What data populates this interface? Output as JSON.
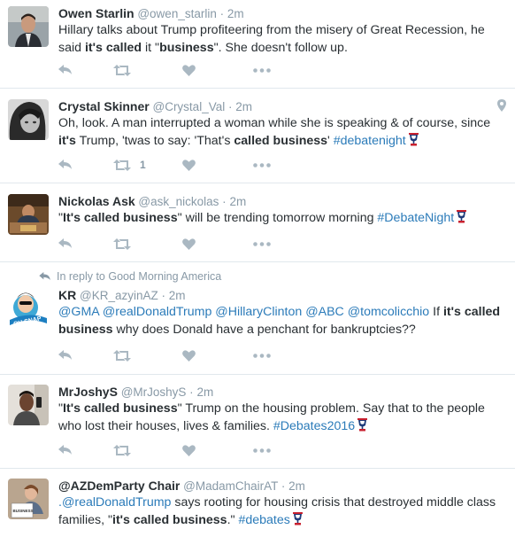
{
  "tweets": [
    {
      "name": "Owen Starlin",
      "handle": "@owen_starlin",
      "time": "2m",
      "text_parts": [
        {
          "t": "Hillary talks about Trump profiteering from the misery of Great Recession, he said ",
          "style": "plain"
        },
        {
          "t": "it's called",
          "style": "bold"
        },
        {
          "t": " it \"",
          "style": "plain"
        },
        {
          "t": "business",
          "style": "bold"
        },
        {
          "t": "\".  She doesn't follow up.",
          "style": "plain"
        }
      ],
      "retweet_count": ""
    },
    {
      "name": "Crystal Skinner",
      "handle": "@Crystal_Val",
      "time": "2m",
      "text_parts": [
        {
          "t": "Oh, look. A man interrupted a woman while she is speaking & of course, since ",
          "style": "plain"
        },
        {
          "t": "it's",
          "style": "bold"
        },
        {
          "t": " Trump, 'twas to say: 'That's ",
          "style": "plain"
        },
        {
          "t": "called business",
          "style": "bold"
        },
        {
          "t": "' ",
          "style": "plain"
        },
        {
          "t": "#debatenight",
          "style": "link"
        }
      ],
      "retweet_count": "1"
    },
    {
      "name": "Nickolas Ask",
      "handle": "@ask_nickolas",
      "time": "2m",
      "text_parts": [
        {
          "t": "\"",
          "style": "plain"
        },
        {
          "t": "It's called business",
          "style": "bold"
        },
        {
          "t": "\" will be trending tomorrow morning ",
          "style": "plain"
        },
        {
          "t": "#DebateNight",
          "style": "link"
        }
      ],
      "retweet_count": ""
    },
    {
      "reply_to_label": "In reply to Good Morning America",
      "name": "KR",
      "handle": "@KR_azyinAZ",
      "time": "2m",
      "text_parts": [
        {
          "t": "@GMA @realDonaldTrump @HillaryClinton @ABC @tomcolicchio",
          "style": "link"
        },
        {
          "t": "  If ",
          "style": "plain"
        },
        {
          "t": "it's called business",
          "style": "bold"
        },
        {
          "t": " why does Donald have a penchant for bankruptcies??",
          "style": "plain"
        }
      ],
      "retweet_count": ""
    },
    {
      "name": "MrJoshyS",
      "handle": "@MrJoshyS",
      "time": "2m",
      "text_parts": [
        {
          "t": "\"",
          "style": "plain"
        },
        {
          "t": "It's called business",
          "style": "bold"
        },
        {
          "t": "\" Trump on the housing problem. Say that to the people who lost their houses, lives & families. ",
          "style": "plain"
        },
        {
          "t": "#Debates2016",
          "style": "link"
        }
      ],
      "retweet_count": ""
    },
    {
      "name": "@AZDemParty Chair",
      "handle": "@MadamChairAT",
      "time": "2m",
      "text_parts": [
        {
          "t": ".@realDonaldTrump",
          "style": "link"
        },
        {
          "t": " says rooting for housing crisis that destroyed middle class families, \"",
          "style": "plain"
        },
        {
          "t": "it's called business",
          "style": "bold"
        },
        {
          "t": ".\" ",
          "style": "plain"
        },
        {
          "t": "#debates",
          "style": "link"
        }
      ],
      "retweet_count": ""
    }
  ],
  "meta": {
    "dot": "·",
    "avatar_sign_text": "BUSINESS",
    "avatar_cartoon_text": "OH SNAP"
  },
  "colors": {
    "link": "#2b7bb9",
    "muted": "#8899a6",
    "icon": "#aab8c2",
    "text": "#292f33"
  }
}
